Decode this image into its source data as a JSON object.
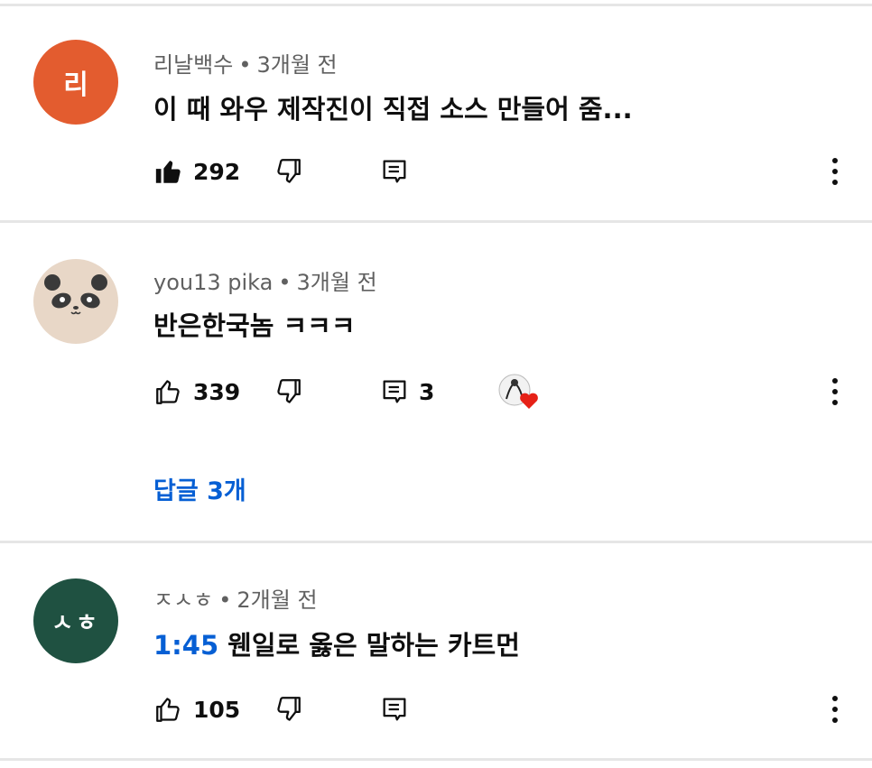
{
  "comments": [
    {
      "author": "리날백수",
      "time": "3개월 전",
      "avatar_letter": "리",
      "avatar_color": "#e35c2f",
      "text": "이 때 와우 제작진이 직접 소스 만들어 줌...",
      "likes": "292",
      "liked": true
    },
    {
      "author": "you13 pika",
      "time": "3개월 전",
      "avatar_icon": "panda-icon",
      "avatar_color": "#e8d7c7",
      "text": "반은한국놈 ㅋㅋㅋ",
      "likes": "339",
      "reply_count": "3",
      "creator_heart": true,
      "replies_label": "답글 3개"
    },
    {
      "author": "ㅈㅅㅎ",
      "time": "2개월 전",
      "avatar_letter": "ㅅㅎ",
      "avatar_color": "#1f5141",
      "timestamp_link": "1:45",
      "text": "웬일로 옳은 말하는 카트먼",
      "likes": "105"
    }
  ],
  "colors": {
    "link": "#065fd4",
    "meta": "#606060",
    "divider": "#e6e6e6"
  }
}
